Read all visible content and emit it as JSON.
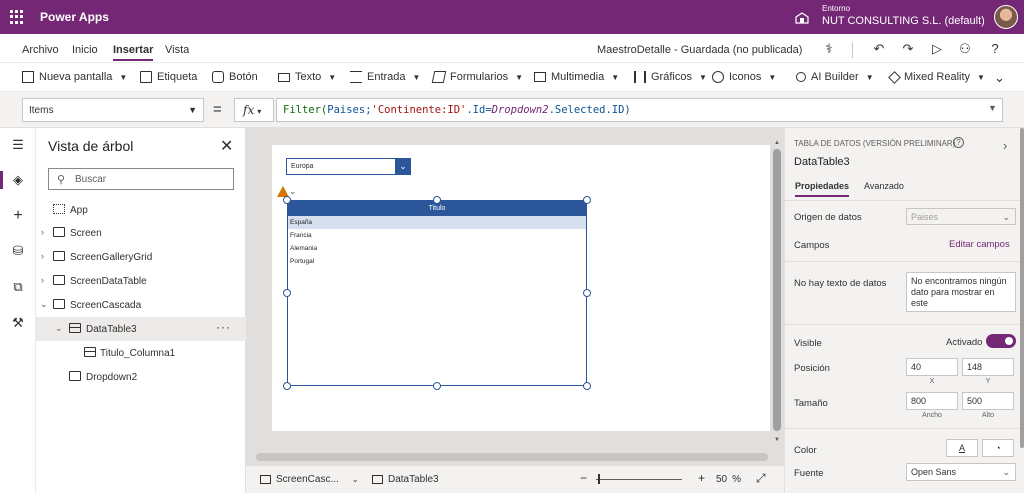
{
  "topbar": {
    "app_name": "Power Apps",
    "env_label": "Entorno",
    "env_name": "NUT CONSULTING S.L. (default)"
  },
  "menu": {
    "items": [
      "Archivo",
      "Inicio",
      "Insertar",
      "Vista"
    ],
    "active": "Insertar",
    "doc_status": "MaestroDetalle - Guardada (no publicada)"
  },
  "ribbon": {
    "items": [
      "Nueva pantalla",
      "Etiqueta",
      "Botón",
      "Texto",
      "Entrada",
      "Formularios",
      "Multimedia",
      "Gráficos",
      "Iconos",
      "AI Builder",
      "Mixed Reality"
    ]
  },
  "formula_bar": {
    "property": "Items",
    "fx_label": "fx",
    "formula": {
      "fn": "Filter(",
      "table": "Paises",
      "sep1": ";",
      "str": "'Continente:ID'",
      "mid": ".Id=",
      "ctl": "Dropdown2",
      "tail": ".Selected.ID)"
    }
  },
  "tree": {
    "title": "Vista de árbol",
    "search_placeholder": "Buscar",
    "nodes": [
      {
        "label": "App"
      },
      {
        "label": "Screen"
      },
      {
        "label": "ScreenGalleryGrid"
      },
      {
        "label": "ScreenDataTable"
      },
      {
        "label": "ScreenCascada"
      },
      {
        "label": "DataTable3"
      },
      {
        "label": "Titulo_Columna1"
      },
      {
        "label": "Dropdown2"
      }
    ]
  },
  "canvas": {
    "dropdown_value": "Europa",
    "table_header": "Titulo",
    "rows": [
      "España",
      "Francia",
      "Alemania",
      "Portugal"
    ]
  },
  "bottombar": {
    "screen": "ScreenCasc...",
    "control": "DataTable3",
    "zoom_minus": "−",
    "zoom_plus": "+",
    "zoom": "50",
    "zoom_unit": "%"
  },
  "props": {
    "type_label": "TABLA DE DATOS (VERSIÓN PRELIMINAR)",
    "name": "DataTable3",
    "tabs": [
      "Propiedades",
      "Avanzado"
    ],
    "data_source_label": "Origen de datos",
    "data_source_value": "Paises",
    "fields_label": "Campos",
    "edit_fields": "Editar campos",
    "no_data_label": "No hay texto de datos",
    "no_data_value": "No encontramos ningún dato para mostrar en este",
    "visible_label": "Visible",
    "visible_value": "Activado",
    "position_label": "Posición",
    "pos_x": "40",
    "pos_y": "148",
    "x_label": "X",
    "y_label": "Y",
    "size_label": "Tamaño",
    "width": "800",
    "height": "500",
    "width_label": "Ancho",
    "height_label": "Alto",
    "color_label": "Color",
    "color_text_glyph": "A",
    "font_label": "Fuente",
    "font_value": "Open Sans"
  },
  "colors": {
    "brand": "#742774",
    "control_blue": "#2b579a",
    "warning": "#d47500"
  }
}
